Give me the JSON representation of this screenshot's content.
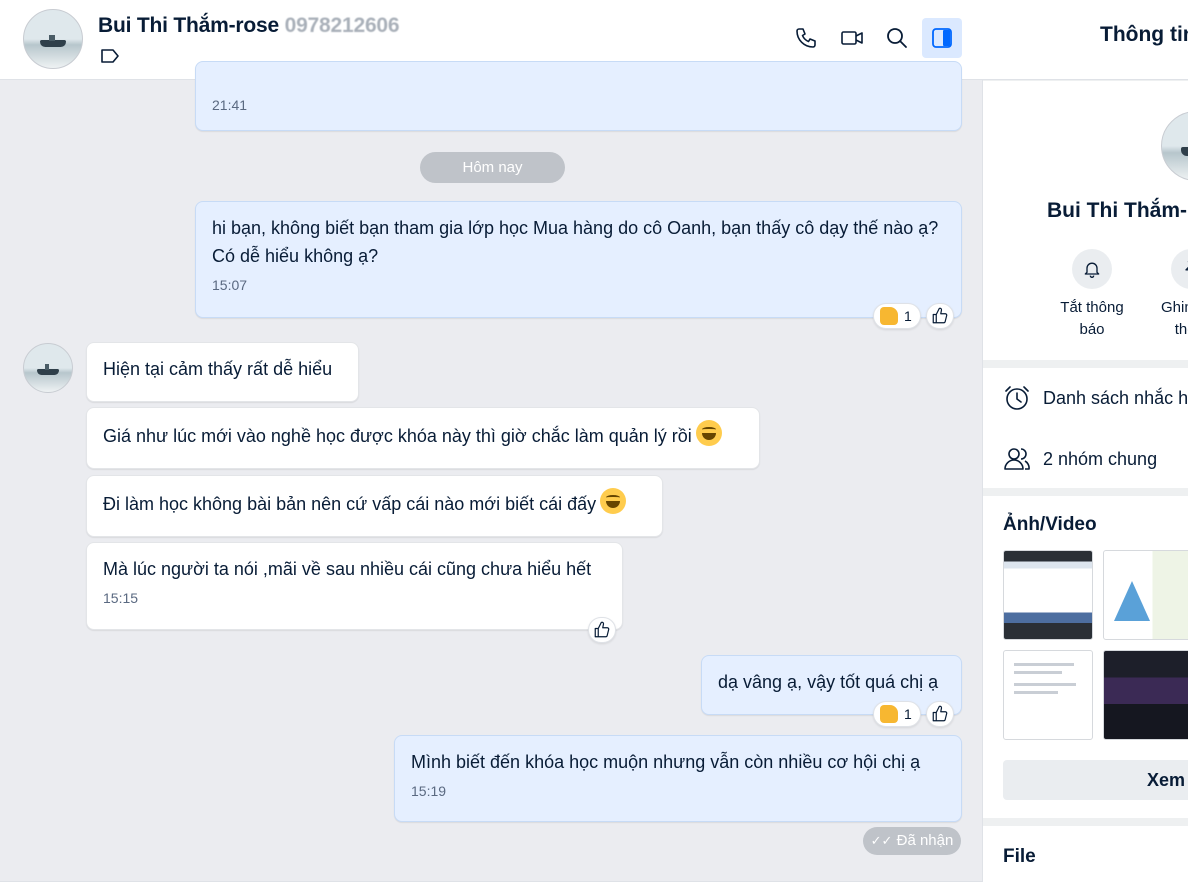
{
  "header": {
    "contact_name": "Bui Thi Thắm-rose",
    "contact_phone_fragment": "0978212606"
  },
  "messages": {
    "prev_time": "21:41",
    "date_separator": "Hôm nay",
    "m1": {
      "text": "hi bạn, không biết bạn tham gia lớp học Mua hàng do cô Oanh, bạn thấy cô dạy thế nào ạ? Có dễ hiểu không ạ?",
      "time": "15:07",
      "reaction_count": "1"
    },
    "r1": {
      "text": "Hiện tại cảm thấy rất dễ hiểu"
    },
    "r2": {
      "text": "Giá như lúc mới vào nghề học được khóa này thì giờ chắc làm quản lý rồi"
    },
    "r3": {
      "text": "Đi làm học không bài bản nên cứ vấp cái nào mới biết cái đấy"
    },
    "r4": {
      "text": "Mà lúc người ta nói ,mãi về sau nhiều cái cũng chưa hiểu hết",
      "time": "15:15"
    },
    "m2": {
      "text": "dạ vâng ạ, vậy tốt quá chị ạ",
      "reaction_count": "1"
    },
    "m3": {
      "text": "Mình biết đến khóa học muộn nhưng vẫn còn nhiều cơ hội chị ạ",
      "time": "15:19"
    },
    "status": "Đã nhận"
  },
  "panel": {
    "title": "Thông tin hội thoại",
    "name": "Bui Thi Thắm-rose",
    "actions": [
      {
        "label": "Tắt thông báo",
        "icon": "bell-icon"
      },
      {
        "label": "Ghim hội thoại",
        "icon": "pin-icon"
      }
    ],
    "reminders": "Danh sách nhắc hẹn",
    "groups": "2 nhóm chung",
    "media_title": "Ảnh/Video",
    "view_all": "Xem tất cả",
    "file_title": "File"
  },
  "colors": {
    "accent": "#0068ff",
    "mine_bubble": "#e5efff",
    "background": "#ebecf0"
  }
}
